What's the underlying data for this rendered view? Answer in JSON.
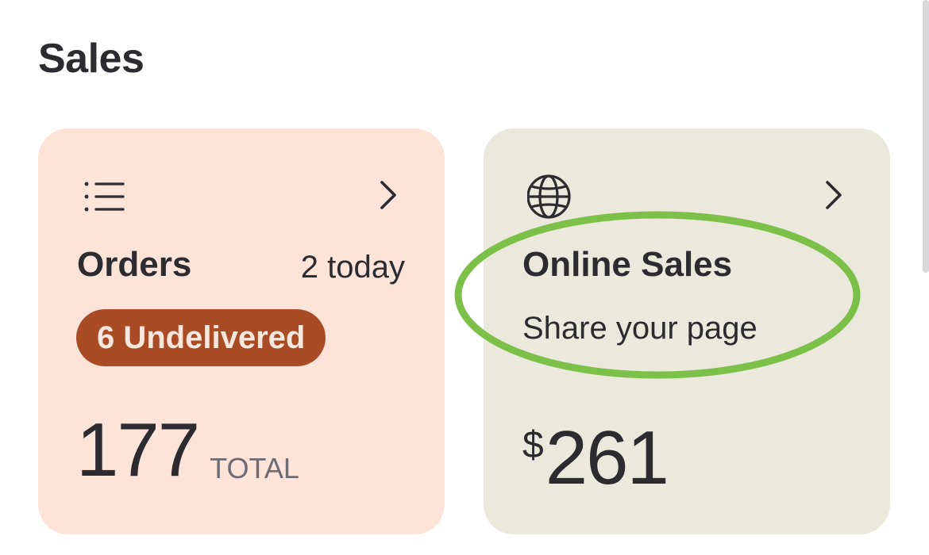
{
  "section": {
    "title": "Sales"
  },
  "orders_card": {
    "icon": "list-icon",
    "title": "Orders",
    "meta": "2 today",
    "badge": "6 Undelivered",
    "total_value": "177",
    "total_label": "TOTAL"
  },
  "online_sales_card": {
    "icon": "globe-icon",
    "title": "Online Sales",
    "subtitle": "Share your page",
    "amount_symbol": "$",
    "amount_value": "261"
  },
  "colors": {
    "orders_card_bg": "#fde3d8",
    "online_sales_card_bg": "#ebe8dc",
    "badge_bg": "#a94b25",
    "highlight_outline": "#7cc04a"
  }
}
